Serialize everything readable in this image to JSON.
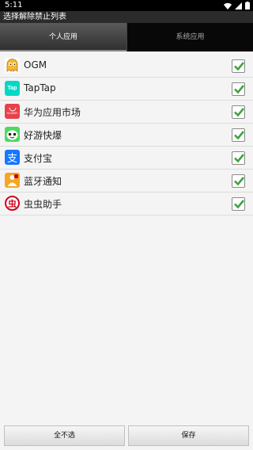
{
  "status_bar": {
    "time": "5:11",
    "icons": [
      "wifi-icon",
      "signal-icon",
      "battery-icon"
    ]
  },
  "title": "选择解除禁止列表",
  "tabs": [
    {
      "label": "个人应用",
      "active": true
    },
    {
      "label": "系统应用",
      "active": false
    }
  ],
  "apps": [
    {
      "name": "OGM",
      "icon": "ogm-icon",
      "checked": true
    },
    {
      "name": "TapTap",
      "icon": "taptap-icon",
      "icon_text": "Tap",
      "checked": true
    },
    {
      "name": "华为应用市场",
      "icon": "huawei-appgallery-icon",
      "icon_text": "HUAWEI",
      "checked": true
    },
    {
      "name": "好游快爆",
      "icon": "haoyoukuaibao-icon",
      "checked": true
    },
    {
      "name": "支付宝",
      "icon": "alipay-icon",
      "icon_text": "支",
      "checked": true
    },
    {
      "name": "蓝牙通知",
      "icon": "bluetooth-notify-icon",
      "checked": true
    },
    {
      "name": "虫虫助手",
      "icon": "chongchong-icon",
      "icon_text": "虫",
      "checked": true
    }
  ],
  "buttons": {
    "clear_label": "全不选",
    "save_label": "保存"
  },
  "colors": {
    "taptap": "#00d9c5",
    "huawei": "#e8414a",
    "alipay": "#1677ff",
    "haoyou": "#4cd964",
    "bluetooth": "#f5a623",
    "chongchong": "#d0021b",
    "check_green": "#3fa33f"
  }
}
